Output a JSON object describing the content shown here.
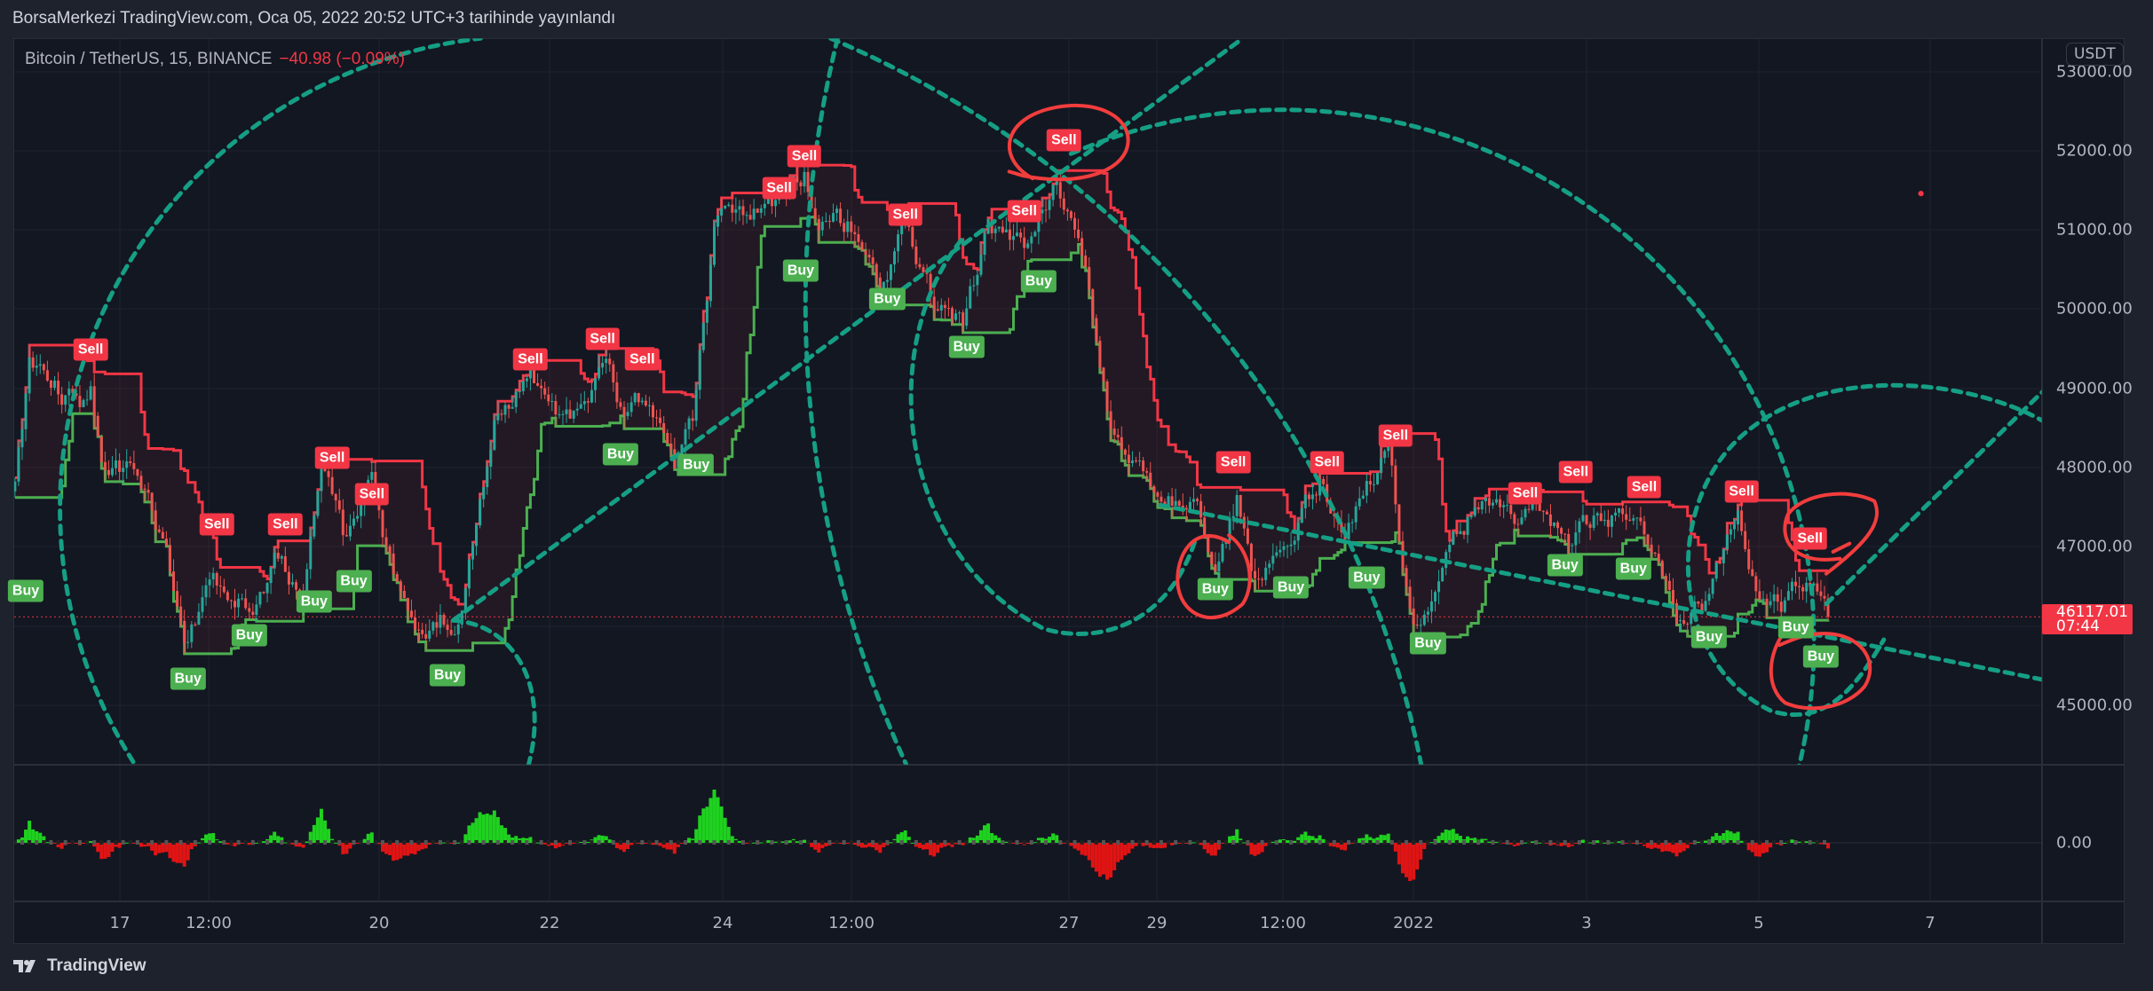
{
  "header": {
    "publish_text": "BorsaMerkezi TradingView.com, Oca 05, 2022 20:52 UTC+3 tarihinde yayınlandı"
  },
  "legend": {
    "symbol": "Bitcoin / TetherUS, 15, BINANCE",
    "change": "−40.98 (−0.09%)"
  },
  "price_axis": {
    "currency": "USDT",
    "labels": [
      "53000.00",
      "52000.00",
      "51000.00",
      "50000.00",
      "49000.00",
      "48000.00",
      "47000.00",
      "45000.00"
    ],
    "indicator_label": "0.00",
    "last_price": "46117.01",
    "countdown": "07:44"
  },
  "time_axis": {
    "labels": [
      "17",
      "12:00",
      "20",
      "22",
      "24",
      "12:00",
      "27",
      "29",
      "12:00",
      "2022",
      "3",
      "5",
      "7"
    ]
  },
  "footer": {
    "brand": "TradingView"
  },
  "colors": {
    "background": "#131722",
    "candle_up": "#26a69a",
    "candle_down": "#ef5350",
    "sell": "#f23645",
    "buy": "#4caf50",
    "drawing": "#159f85",
    "annotation": "#f23d3d",
    "hist_up": "#1fd11f",
    "hist_down": "#e01414"
  },
  "chart_data": {
    "type": "candlestick",
    "symbol": "Bitcoin / TetherUS",
    "interval": "15",
    "ylim": [
      44300,
      53300
    ],
    "last_price": 46117.01,
    "grid": true,
    "price_keypoints": [
      [
        "12-15 19:00",
        47700
      ],
      [
        "12-15 23:00",
        49200
      ],
      [
        "12-16 14:00",
        48800
      ],
      [
        "12-16 16:00",
        49000
      ],
      [
        "12-16 19:00",
        48000
      ],
      [
        "12-17 05:00",
        48000
      ],
      [
        "12-17 13:00",
        47000
      ],
      [
        "12-17 18:00",
        45600
      ],
      [
        "12-18 02:00",
        46800
      ],
      [
        "12-18 06:00",
        46200
      ],
      [
        "12-18 11:00",
        46200
      ],
      [
        "12-18 21:00",
        46900
      ],
      [
        "12-19 03:00",
        46400
      ],
      [
        "12-19 08:00",
        48000
      ],
      [
        "12-19 14:00",
        47000
      ],
      [
        "12-19 22:00",
        47800
      ],
      [
        "12-20 03:00",
        46800
      ],
      [
        "12-20 13:00",
        45700
      ],
      [
        "12-20 17:00",
        46000
      ],
      [
        "12-20 21:00",
        45900
      ],
      [
        "12-21 02:00",
        47000
      ],
      [
        "12-21 08:00",
        48600
      ],
      [
        "12-21 18:00",
        49100
      ],
      [
        "12-22 03:00",
        48400
      ],
      [
        "12-22 15:00",
        49200
      ],
      [
        "12-22 20:00",
        48500
      ],
      [
        "12-23 02:00",
        48800
      ],
      [
        "12-23 10:00",
        48000
      ],
      [
        "12-23 15:00",
        48600
      ],
      [
        "12-23 21:00",
        51000
      ],
      [
        "12-24 01:00",
        51200
      ],
      [
        "12-24 14:00",
        51300
      ],
      [
        "12-24 22:00",
        51700
      ],
      [
        "12-25 02:00",
        51000
      ],
      [
        "12-25 11:00",
        51000
      ],
      [
        "12-25 19:00",
        50400
      ],
      [
        "12-26 02:00",
        51000
      ],
      [
        "12-26 10:00",
        50000
      ],
      [
        "12-26 18:00",
        49800
      ],
      [
        "12-27 01:00",
        51000
      ],
      [
        "12-27 11:00",
        50800
      ],
      [
        "12-27 20:00",
        51700
      ],
      [
        "12-28 02:00",
        51000
      ],
      [
        "12-28 08:00",
        49500
      ],
      [
        "12-28 11:00",
        48500
      ],
      [
        "12-28 19:00",
        48000
      ],
      [
        "12-28 23:00",
        47500
      ],
      [
        "12-29 10:00",
        47700
      ],
      [
        "12-29 16:00",
        46900
      ],
      [
        "12-29 22:00",
        47700
      ],
      [
        "12-30 03:00",
        46600
      ],
      [
        "12-30 13:00",
        47000
      ],
      [
        "12-30 21:00",
        47800
      ],
      [
        "12-31 04:00",
        47000
      ],
      [
        "12-31 12:00",
        47900
      ],
      [
        "12-31 16:00",
        48400
      ],
      [
        "12-31 19:00",
        47300
      ],
      [
        "12-31 23:00",
        46000
      ],
      [
        "01-01 03:00",
        46400
      ],
      [
        "01-01 11:00",
        47100
      ],
      [
        "01-01 18:00",
        47700
      ],
      [
        "01-02 02:00",
        47300
      ],
      [
        "01-02 10:00",
        47400
      ],
      [
        "01-02 19:00",
        47100
      ],
      [
        "01-03 01:00",
        47300
      ],
      [
        "01-03 12:00",
        47400
      ],
      [
        "01-03 20:00",
        46800
      ],
      [
        "01-04 00:00",
        46200
      ],
      [
        "01-04 07:00",
        46300
      ],
      [
        "01-04 17:00",
        47400
      ],
      [
        "01-04 23:00",
        46300
      ],
      [
        "01-05 06:00",
        46300
      ],
      [
        "01-05 14:00",
        46700
      ],
      [
        "01-05 18:00",
        46117
      ]
    ],
    "signals": [
      {
        "type": "Sell",
        "time": "12-16 16:00",
        "price": 49490
      },
      {
        "type": "Sell",
        "time": "12-18 03:00",
        "price": 47290
      },
      {
        "type": "Sell",
        "time": "12-18 22:00",
        "price": 47290
      },
      {
        "type": "Sell",
        "time": "12-19 11:00",
        "price": 48120
      },
      {
        "type": "Sell",
        "time": "12-19 22:00",
        "price": 47670
      },
      {
        "type": "Sell",
        "time": "12-21 18:00",
        "price": 49370
      },
      {
        "type": "Sell",
        "time": "12-22 14:00",
        "price": 49630
      },
      {
        "type": "Sell",
        "time": "12-23 01:00",
        "price": 49370
      },
      {
        "type": "Sell",
        "time": "12-24 15:00",
        "price": 51530
      },
      {
        "type": "Sell",
        "time": "12-24 22:00",
        "price": 51930
      },
      {
        "type": "Sell",
        "time": "12-26 02:00",
        "price": 51190
      },
      {
        "type": "Sell",
        "time": "12-27 11:00",
        "price": 51240
      },
      {
        "type": "Sell",
        "time": "12-27 22:00",
        "price": 52140
      },
      {
        "type": "Sell",
        "time": "12-29 21:00",
        "price": 48070
      },
      {
        "type": "Sell",
        "time": "12-30 23:00",
        "price": 48070
      },
      {
        "type": "Sell",
        "time": "12-31 18:00",
        "price": 48410
      },
      {
        "type": "Sell",
        "time": "01-02 06:00",
        "price": 47680
      },
      {
        "type": "Sell",
        "time": "01-02 20:00",
        "price": 47940
      },
      {
        "type": "Sell",
        "time": "01-03 15:00",
        "price": 47750
      },
      {
        "type": "Sell",
        "time": "01-04 18:00",
        "price": 47700
      },
      {
        "type": "Sell",
        "time": "01-05 13:00",
        "price": 47110
      },
      {
        "type": "Buy",
        "time": "12-15 22:00",
        "price": 46450
      },
      {
        "type": "Buy",
        "time": "12-17 19:00",
        "price": 45330
      },
      {
        "type": "Buy",
        "time": "12-18 12:00",
        "price": 45880
      },
      {
        "type": "Buy",
        "time": "12-19 06:00",
        "price": 46310
      },
      {
        "type": "Buy",
        "time": "12-19 17:00",
        "price": 46570
      },
      {
        "type": "Buy",
        "time": "12-20 19:00",
        "price": 45380
      },
      {
        "type": "Buy",
        "time": "12-22 19:00",
        "price": 48170
      },
      {
        "type": "Buy",
        "time": "12-23 16:00",
        "price": 48030
      },
      {
        "type": "Buy",
        "time": "12-24 21:00",
        "price": 50490
      },
      {
        "type": "Buy",
        "time": "12-25 21:00",
        "price": 50130
      },
      {
        "type": "Buy",
        "time": "12-26 19:00",
        "price": 49520
      },
      {
        "type": "Buy",
        "time": "12-27 15:00",
        "price": 50350
      },
      {
        "type": "Buy",
        "time": "12-29 16:00",
        "price": 46470
      },
      {
        "type": "Buy",
        "time": "12-30 13:00",
        "price": 46490
      },
      {
        "type": "Buy",
        "time": "12-31 10:00",
        "price": 46610
      },
      {
        "type": "Buy",
        "time": "01-01 03:00",
        "price": 45780
      },
      {
        "type": "Buy",
        "time": "01-02 17:00",
        "price": 46770
      },
      {
        "type": "Buy",
        "time": "01-03 12:00",
        "price": 46730
      },
      {
        "type": "Buy",
        "time": "01-04 09:00",
        "price": 45860
      },
      {
        "type": "Buy",
        "time": "01-05 09:00",
        "price": 45990
      },
      {
        "type": "Buy",
        "time": "01-05 16:00",
        "price": 45620
      }
    ]
  }
}
